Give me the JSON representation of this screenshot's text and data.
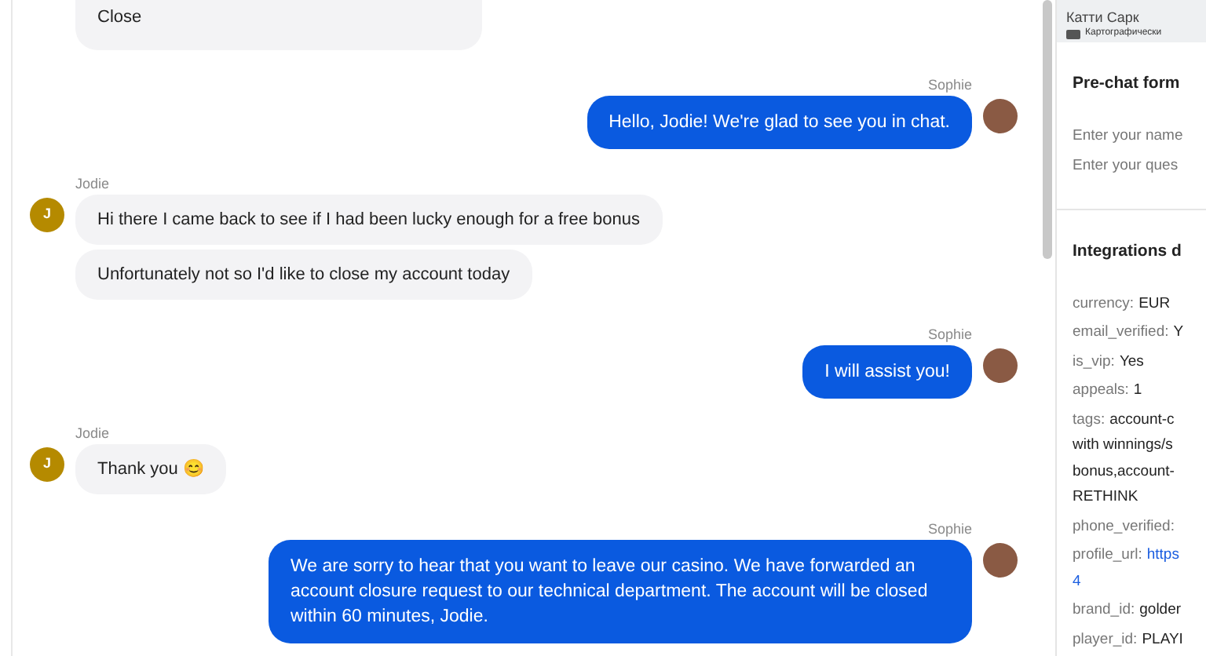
{
  "messages": [
    {
      "kind": "visitor",
      "cut_top": true,
      "bubbles": [
        "Close"
      ]
    },
    {
      "kind": "agent",
      "name": "Sophie",
      "bubbles": [
        "Hello, Jodie! We're glad to see you in chat."
      ]
    },
    {
      "kind": "visitor",
      "name": "Jodie",
      "initial": "J",
      "bubbles": [
        "Hi there I came back to see if I had been lucky enough for a free bonus",
        "Unfortunately not so I'd like to close my account today"
      ]
    },
    {
      "kind": "agent",
      "name": "Sophie",
      "bubbles": [
        "I will assist you!"
      ]
    },
    {
      "kind": "visitor",
      "name": "Jodie",
      "initial": "J",
      "bubbles": [
        "Thank you 😊"
      ]
    },
    {
      "kind": "agent",
      "name": "Sophie",
      "bubbles": [
        "We are sorry to hear that you want to leave our casino. We have forwarded an account closure request to our technical department. The account will be closed within 60 minutes, Jodie."
      ]
    }
  ],
  "map": {
    "place": "Катти Сарк",
    "attribution": "Картографически"
  },
  "prechat": {
    "title": "Pre-chat form",
    "fields": [
      {
        "placeholder": "Enter your name"
      },
      {
        "placeholder": "Enter your ques"
      }
    ]
  },
  "integrations": {
    "title": "Integrations d",
    "items": [
      {
        "kind": "text",
        "label": "currency:",
        "lines": [
          "EUR"
        ]
      },
      {
        "kind": "text",
        "label": "email_verified:",
        "lines": [
          "Y"
        ]
      },
      {
        "kind": "text",
        "label": "is_vip:",
        "lines": [
          "Yes"
        ]
      },
      {
        "kind": "text",
        "label": "appeals:",
        "lines": [
          "1"
        ]
      },
      {
        "kind": "text",
        "label": "tags:",
        "lines": [
          "account-c",
          "with winnings/s",
          "bonus,account-",
          "RETHINK"
        ]
      },
      {
        "kind": "label",
        "label": "phone_verified:"
      },
      {
        "kind": "link",
        "label": "profile_url:",
        "lines": [
          "https",
          "4"
        ]
      },
      {
        "kind": "text",
        "label": "brand_id:",
        "lines": [
          "golder"
        ]
      },
      {
        "kind": "text",
        "label": "player_id:",
        "lines": [
          "PLAYI"
        ]
      }
    ]
  }
}
